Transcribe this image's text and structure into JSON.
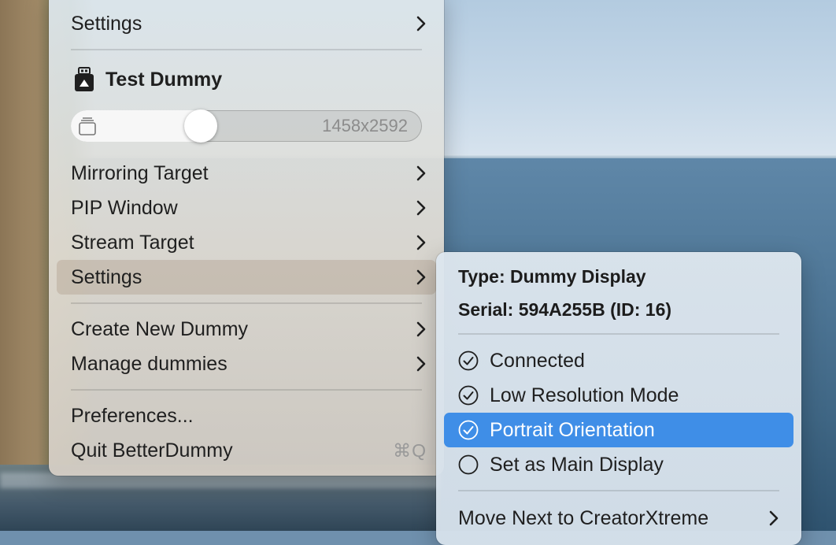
{
  "main_menu": {
    "top_settings_label": "Settings",
    "device_name": "Test Dummy",
    "resolution_slider": {
      "value_label": "1458x2592",
      "level_fraction": 0.37
    },
    "items": [
      {
        "label": "Mirroring Target"
      },
      {
        "label": "PIP Window"
      },
      {
        "label": "Stream Target"
      },
      {
        "label": "Settings"
      },
      {
        "label": "Create New Dummy"
      },
      {
        "label": "Manage dummies"
      },
      {
        "label": "Preferences..."
      },
      {
        "label": "Quit BetterDummy",
        "shortcut": "⌘Q"
      }
    ]
  },
  "settings_submenu": {
    "type_line": "Type: Dummy Display",
    "serial_line": "Serial: 594A255B (ID: 16)",
    "options": [
      {
        "label": "Connected",
        "checked": true
      },
      {
        "label": "Low Resolution Mode",
        "checked": true
      },
      {
        "label": "Portrait Orientation",
        "checked": true,
        "highlighted": true
      },
      {
        "label": "Set as Main Display",
        "checked": false
      }
    ],
    "move_next_label": "Move Next to CreatorXtreme"
  },
  "colors": {
    "selection_blue": "#3f8ee7",
    "hover_grey": "#b8a58f"
  },
  "icons": {
    "device_icon": "usb-display-icon",
    "slider_icon": "display-stack-icon",
    "submenu_chevron": "chevron-right-icon",
    "checked": "check-circle-icon",
    "unchecked": "empty-circle-icon"
  }
}
